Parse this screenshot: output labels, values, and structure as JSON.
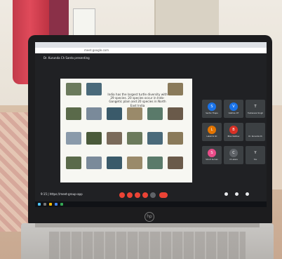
{
  "scene": {
    "browser_url": "meet.google.com",
    "presenter_banner": "Dr. Kurunda Ch Santa presenting",
    "slide_text": "India has the largest turtle diversity with 29 species. 20 species occur in Indo-Gangetic plain and 20 species in North East India",
    "meeting_code": "https://meet-group-app",
    "clock": "9:15",
    "brand_logo": "hp"
  },
  "participants": [
    {
      "name": "Sachin Thapa",
      "initial": "S",
      "color": "#1a73e8"
    },
    {
      "name": "Vaibhav DT",
      "initial": "V",
      "color": "#1a73e8"
    },
    {
      "name": "Tushanwar Singh",
      "initial": "T",
      "color": "#3c4043"
    },
    {
      "name": "Lakshmi KC",
      "initial": "L",
      "color": "#e37400"
    },
    {
      "name": "Bhai Vaibhav",
      "initial": "B",
      "color": "#d93025"
    },
    {
      "name": "Dr. Kurunda Ch",
      "initial": "",
      "color": "#3c4043"
    },
    {
      "name": "Shruti Suman",
      "initial": "S",
      "color": "#ea4c89"
    },
    {
      "name": "Ch akara",
      "initial": "C",
      "color": "#5f6368"
    },
    {
      "name": "You",
      "initial": "Y",
      "color": "#3c4043"
    }
  ]
}
